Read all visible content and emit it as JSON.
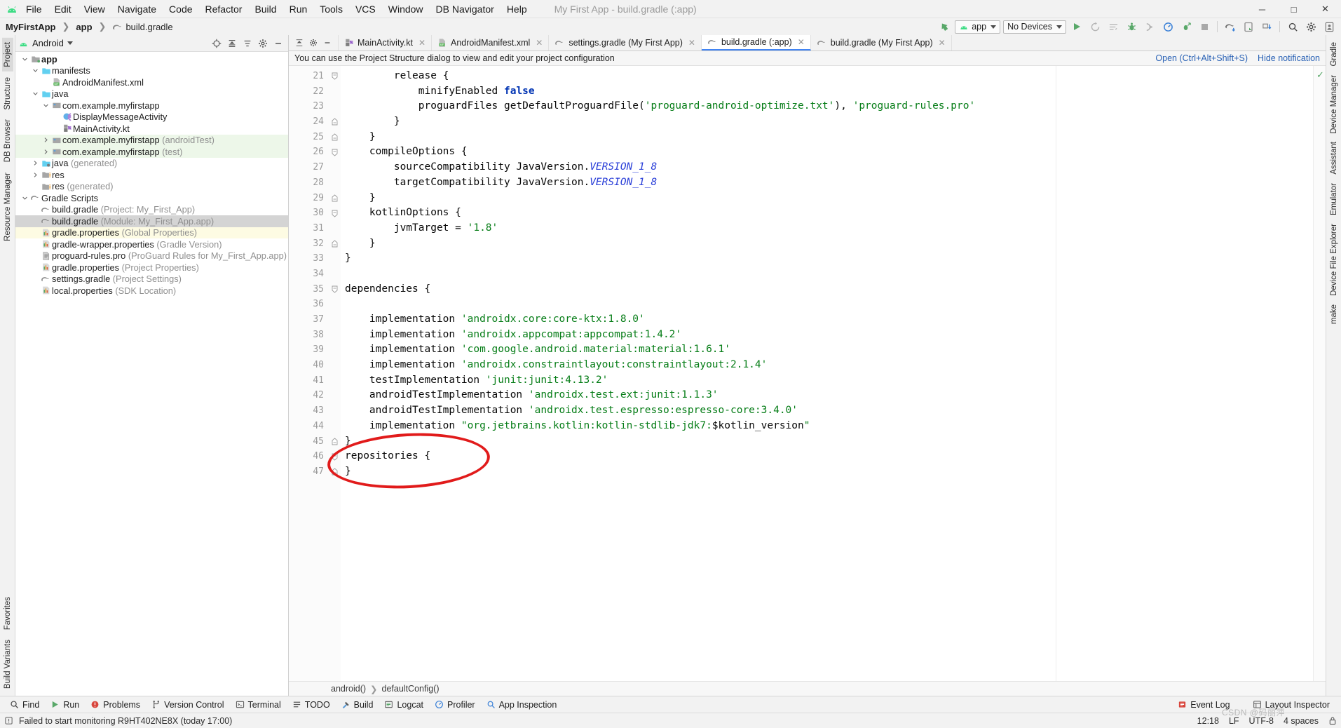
{
  "window": {
    "title": "My First App - build.gradle (:app)",
    "minimize": "─",
    "maximize": "□",
    "close": "✕"
  },
  "menubar": {
    "logo": "android-logo",
    "items": [
      "File",
      "Edit",
      "View",
      "Navigate",
      "Code",
      "Refactor",
      "Build",
      "Run",
      "Tools",
      "VCS",
      "Window",
      "DB Navigator",
      "Help"
    ]
  },
  "navbar": {
    "breadcrumbs": [
      "MyFirstApp",
      "app",
      "build.gradle"
    ],
    "module_selector": "app",
    "device_selector": "No Devices",
    "icons": [
      "run-icon",
      "rerun-icon",
      "edit-configurations-icon",
      "debug-icon",
      "attach-debugger-icon",
      "profiler-icon",
      "run-with-coverage-icon",
      "stop-icon",
      "sync-gradle-icon",
      "avd-manager-icon",
      "sdk-manager-icon",
      "search-everywhere-icon",
      "settings-gear-icon",
      "account-icon"
    ]
  },
  "left_stripe": {
    "top": [
      "Project",
      "Structure",
      "DB Browser",
      "Resource Manager"
    ],
    "bottom": [
      "Favorites",
      "Build Variants"
    ]
  },
  "right_stripe": {
    "items": [
      "Gradle",
      "Device Manager",
      "Assistant",
      "Emulator",
      "Device File Explorer",
      "make"
    ]
  },
  "project_panel": {
    "title": "Android",
    "header_icons": [
      "target-icon",
      "collapse-all-icon",
      "sort-icon",
      "settings-icon",
      "hide-icon"
    ],
    "tree": [
      {
        "indent": 0,
        "arrow": "down",
        "icon": "module-icon",
        "label": "app",
        "sub": "",
        "bold": true,
        "state": ""
      },
      {
        "indent": 1,
        "arrow": "down",
        "icon": "folder-icon",
        "label": "manifests",
        "sub": "",
        "bold": false,
        "state": ""
      },
      {
        "indent": 2,
        "arrow": "none",
        "icon": "manifest-file-icon",
        "label": "AndroidManifest.xml",
        "sub": "",
        "bold": false,
        "state": ""
      },
      {
        "indent": 1,
        "arrow": "down",
        "icon": "folder-icon",
        "label": "java",
        "sub": "",
        "bold": false,
        "state": ""
      },
      {
        "indent": 2,
        "arrow": "down",
        "icon": "package-icon",
        "label": "com.example.myfirstapp",
        "sub": "",
        "bold": false,
        "state": ""
      },
      {
        "indent": 3,
        "arrow": "none",
        "icon": "kotlin-class-icon",
        "label": "DisplayMessageActivity",
        "sub": "",
        "bold": false,
        "state": ""
      },
      {
        "indent": 3,
        "arrow": "none",
        "icon": "kotlin-file-icon",
        "label": "MainActivity.kt",
        "sub": "",
        "bold": false,
        "state": ""
      },
      {
        "indent": 2,
        "arrow": "right",
        "icon": "package-icon",
        "label": "com.example.myfirstapp",
        "sub": " (androidTest)",
        "bold": false,
        "state": "green"
      },
      {
        "indent": 2,
        "arrow": "right",
        "icon": "package-icon",
        "label": "com.example.myfirstapp",
        "sub": " (test)",
        "bold": false,
        "state": "green"
      },
      {
        "indent": 1,
        "arrow": "right",
        "icon": "generated-folder-icon",
        "label": "java",
        "sub": " (generated)",
        "bold": false,
        "state": ""
      },
      {
        "indent": 1,
        "arrow": "right",
        "icon": "res-folder-icon",
        "label": "res",
        "sub": "",
        "bold": false,
        "state": ""
      },
      {
        "indent": 1,
        "arrow": "none",
        "icon": "res-folder-icon",
        "label": "res",
        "sub": " (generated)",
        "bold": false,
        "state": ""
      },
      {
        "indent": 0,
        "arrow": "down",
        "icon": "gradle-icon",
        "label": "Gradle Scripts",
        "sub": "",
        "bold": false,
        "state": ""
      },
      {
        "indent": 1,
        "arrow": "none",
        "icon": "gradle-icon",
        "label": "build.gradle",
        "sub": " (Project: My_First_App)",
        "bold": false,
        "state": ""
      },
      {
        "indent": 1,
        "arrow": "none",
        "icon": "gradle-icon",
        "label": "build.gradle",
        "sub": " (Module: My_First_App.app)",
        "bold": false,
        "state": "sel"
      },
      {
        "indent": 1,
        "arrow": "none",
        "icon": "properties-icon",
        "label": "gradle.properties",
        "sub": " (Global Properties)",
        "bold": false,
        "state": "yellow"
      },
      {
        "indent": 1,
        "arrow": "none",
        "icon": "properties-icon",
        "label": "gradle-wrapper.properties",
        "sub": " (Gradle Version)",
        "bold": false,
        "state": ""
      },
      {
        "indent": 1,
        "arrow": "none",
        "icon": "text-file-icon",
        "label": "proguard-rules.pro",
        "sub": " (ProGuard Rules for My_First_App.app)",
        "bold": false,
        "state": ""
      },
      {
        "indent": 1,
        "arrow": "none",
        "icon": "properties-icon",
        "label": "gradle.properties",
        "sub": " (Project Properties)",
        "bold": false,
        "state": ""
      },
      {
        "indent": 1,
        "arrow": "none",
        "icon": "gradle-icon",
        "label": "settings.gradle",
        "sub": " (Project Settings)",
        "bold": false,
        "state": ""
      },
      {
        "indent": 1,
        "arrow": "none",
        "icon": "properties-icon",
        "label": "local.properties",
        "sub": " (SDK Location)",
        "bold": false,
        "state": ""
      }
    ]
  },
  "editor": {
    "tab_tools": [
      "expand-icon",
      "settings-icon",
      "minimize-icon"
    ],
    "tabs": [
      {
        "label": "MainActivity.kt",
        "icon": "kotlin-file-icon",
        "active": false
      },
      {
        "label": "AndroidManifest.xml",
        "icon": "manifest-file-icon",
        "active": false
      },
      {
        "label": "settings.gradle (My First App)",
        "icon": "gradle-icon",
        "active": false
      },
      {
        "label": "build.gradle (:app)",
        "icon": "gradle-icon",
        "active": true
      },
      {
        "label": "build.gradle (My First App)",
        "icon": "gradle-icon",
        "active": false
      }
    ],
    "notification": {
      "text": "You can use the Project Structure dialog to view and edit your project configuration",
      "open_link": "Open (Ctrl+Alt+Shift+S)",
      "hide_link": "Hide notification"
    },
    "first_line_number": 21,
    "lines": [
      {
        "n": 21,
        "fold": "minus-open",
        "tokens": [
          {
            "t": "        release ",
            "c": "plain"
          },
          {
            "t": "{",
            "c": "plain"
          }
        ]
      },
      {
        "n": 22,
        "fold": "",
        "tokens": [
          {
            "t": "            minifyEnabled ",
            "c": "plain"
          },
          {
            "t": "false",
            "c": "kw"
          }
        ]
      },
      {
        "n": 23,
        "fold": "",
        "tokens": [
          {
            "t": "            proguardFiles getDefaultProguardFile(",
            "c": "plain"
          },
          {
            "t": "'proguard-android-optimize.txt'",
            "c": "str"
          },
          {
            "t": "), ",
            "c": "plain"
          },
          {
            "t": "'proguard-rules.pro'",
            "c": "str"
          }
        ]
      },
      {
        "n": 24,
        "fold": "plus-close",
        "tokens": [
          {
            "t": "        }",
            "c": "plain"
          }
        ]
      },
      {
        "n": 25,
        "fold": "plus-close",
        "tokens": [
          {
            "t": "    }",
            "c": "plain"
          }
        ]
      },
      {
        "n": 26,
        "fold": "minus-open",
        "tokens": [
          {
            "t": "    compileOptions ",
            "c": "plain"
          },
          {
            "t": "{",
            "c": "plain"
          }
        ]
      },
      {
        "n": 27,
        "fold": "",
        "tokens": [
          {
            "t": "        sourceCompatibility JavaVersion.",
            "c": "plain"
          },
          {
            "t": "VERSION_1_8",
            "c": "cst"
          }
        ]
      },
      {
        "n": 28,
        "fold": "",
        "tokens": [
          {
            "t": "        targetCompatibility JavaVersion.",
            "c": "plain"
          },
          {
            "t": "VERSION_1_8",
            "c": "cst"
          }
        ]
      },
      {
        "n": 29,
        "fold": "plus-close",
        "tokens": [
          {
            "t": "    }",
            "c": "plain"
          }
        ]
      },
      {
        "n": 30,
        "fold": "minus-open",
        "tokens": [
          {
            "t": "    kotlinOptions ",
            "c": "plain"
          },
          {
            "t": "{",
            "c": "plain"
          }
        ]
      },
      {
        "n": 31,
        "fold": "",
        "tokens": [
          {
            "t": "        jvmTarget = ",
            "c": "plain"
          },
          {
            "t": "'1.8'",
            "c": "str"
          }
        ]
      },
      {
        "n": 32,
        "fold": "plus-close",
        "tokens": [
          {
            "t": "    }",
            "c": "plain"
          }
        ]
      },
      {
        "n": 33,
        "fold": "",
        "tokens": [
          {
            "t": "}",
            "c": "plain"
          }
        ]
      },
      {
        "n": 34,
        "fold": "",
        "tokens": [
          {
            "t": "",
            "c": "plain"
          }
        ]
      },
      {
        "n": 35,
        "fold": "minus-open",
        "tokens": [
          {
            "t": "dependencies ",
            "c": "plain"
          },
          {
            "t": "{",
            "c": "plain"
          }
        ]
      },
      {
        "n": 36,
        "fold": "",
        "tokens": [
          {
            "t": "",
            "c": "plain"
          }
        ]
      },
      {
        "n": 37,
        "fold": "",
        "tokens": [
          {
            "t": "    implementation ",
            "c": "plain"
          },
          {
            "t": "'androidx.core:core-ktx:1.8.0'",
            "c": "str"
          }
        ]
      },
      {
        "n": 38,
        "fold": "",
        "tokens": [
          {
            "t": "    implementation ",
            "c": "plain"
          },
          {
            "t": "'androidx.appcompat:appcompat:1.4.2'",
            "c": "str"
          }
        ]
      },
      {
        "n": 39,
        "fold": "",
        "tokens": [
          {
            "t": "    implementation ",
            "c": "plain"
          },
          {
            "t": "'com.google.android.material:material:1.6.1'",
            "c": "str"
          }
        ]
      },
      {
        "n": 40,
        "fold": "",
        "tokens": [
          {
            "t": "    implementation ",
            "c": "plain"
          },
          {
            "t": "'androidx.constraintlayout:constraintlayout:2.1.4'",
            "c": "str"
          }
        ]
      },
      {
        "n": 41,
        "fold": "",
        "tokens": [
          {
            "t": "    testImplementation ",
            "c": "plain"
          },
          {
            "t": "'junit:junit:4.13.2'",
            "c": "str"
          }
        ]
      },
      {
        "n": 42,
        "fold": "",
        "tokens": [
          {
            "t": "    androidTestImplementation ",
            "c": "plain"
          },
          {
            "t": "'androidx.test.ext:junit:1.1.3'",
            "c": "str"
          }
        ]
      },
      {
        "n": 43,
        "fold": "",
        "tokens": [
          {
            "t": "    androidTestImplementation ",
            "c": "plain"
          },
          {
            "t": "'androidx.test.espresso:espresso-core:3.4.0'",
            "c": "str"
          }
        ]
      },
      {
        "n": 44,
        "fold": "",
        "tokens": [
          {
            "t": "    implementation ",
            "c": "plain"
          },
          {
            "t": "\"org.jetbrains.kotlin:kotlin-stdlib-jdk7:",
            "c": "str"
          },
          {
            "t": "$kotlin_version",
            "c": "plain"
          },
          {
            "t": "\"",
            "c": "str"
          }
        ]
      },
      {
        "n": 45,
        "fold": "plus-close",
        "tokens": [
          {
            "t": "}",
            "c": "plain"
          }
        ]
      },
      {
        "n": 46,
        "fold": "minus-open",
        "tokens": [
          {
            "t": "repositories ",
            "c": "plain"
          },
          {
            "t": "{",
            "c": "plain"
          }
        ]
      },
      {
        "n": 47,
        "fold": "plus-close",
        "tokens": [
          {
            "t": "}",
            "c": "plain"
          }
        ]
      }
    ],
    "bottom_breadcrumb": [
      "android()",
      "defaultConfig()"
    ],
    "inspection_status": "ok-check"
  },
  "annotation": {
    "shape": "red-ellipse",
    "target_lines": [
      46,
      47
    ]
  },
  "bottom_toolwindows": [
    {
      "label": "Find",
      "icon": "search-icon"
    },
    {
      "label": "Run",
      "icon": "run-icon"
    },
    {
      "label": "Problems",
      "icon": "problems-icon"
    },
    {
      "label": "Version Control",
      "icon": "branch-icon"
    },
    {
      "label": "Terminal",
      "icon": "terminal-icon"
    },
    {
      "label": "TODO",
      "icon": "todo-icon"
    },
    {
      "label": "Build",
      "icon": "build-hammer-icon"
    },
    {
      "label": "Logcat",
      "icon": "logcat-icon"
    },
    {
      "label": "Profiler",
      "icon": "profiler-icon"
    },
    {
      "label": "App Inspection",
      "icon": "inspection-icon"
    }
  ],
  "bottom_right_tools": [
    {
      "label": "Event Log",
      "icon": "event-log-icon"
    },
    {
      "label": "Layout Inspector",
      "icon": "layout-inspector-icon"
    }
  ],
  "statusbar": {
    "message": "Failed to start monitoring R9HT402NE8X (today 17:00)",
    "message_icon": "warning-icon",
    "position": "12:18",
    "line_separator": "LF",
    "encoding": "UTF-8",
    "indent": "4 spaces",
    "lock_icon": "lock-icon"
  },
  "watermark": "CSDN @码丽萍",
  "colors": {
    "accent_blue": "#4285f4",
    "android_green": "#3ddc84",
    "keyword_blue": "#0033b3",
    "string_green": "#067d17",
    "annotation_red": "#e11b1b",
    "selection_gray": "#d4d4d4",
    "test_green_bg": "#edf7e9",
    "yellow_bg": "#fdfbe3"
  }
}
